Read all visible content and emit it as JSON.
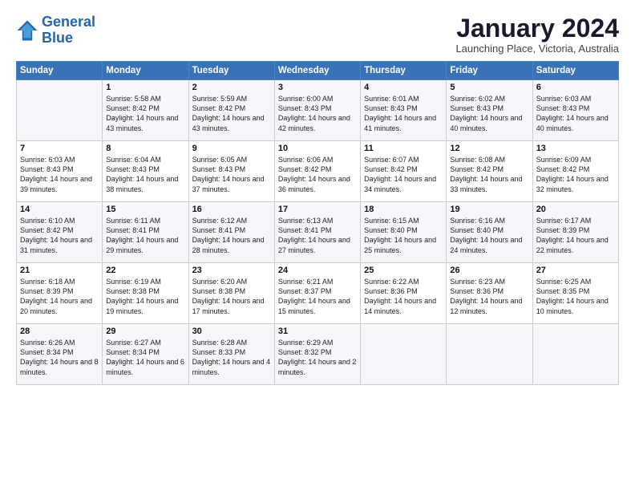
{
  "logo": {
    "line1": "General",
    "line2": "Blue"
  },
  "title": "January 2024",
  "subtitle": "Launching Place, Victoria, Australia",
  "days_header": [
    "Sunday",
    "Monday",
    "Tuesday",
    "Wednesday",
    "Thursday",
    "Friday",
    "Saturday"
  ],
  "weeks": [
    [
      {
        "day": "",
        "sunrise": "",
        "sunset": "",
        "daylight": ""
      },
      {
        "day": "1",
        "sunrise": "Sunrise: 5:58 AM",
        "sunset": "Sunset: 8:42 PM",
        "daylight": "Daylight: 14 hours and 43 minutes."
      },
      {
        "day": "2",
        "sunrise": "Sunrise: 5:59 AM",
        "sunset": "Sunset: 8:42 PM",
        "daylight": "Daylight: 14 hours and 43 minutes."
      },
      {
        "day": "3",
        "sunrise": "Sunrise: 6:00 AM",
        "sunset": "Sunset: 8:43 PM",
        "daylight": "Daylight: 14 hours and 42 minutes."
      },
      {
        "day": "4",
        "sunrise": "Sunrise: 6:01 AM",
        "sunset": "Sunset: 8:43 PM",
        "daylight": "Daylight: 14 hours and 41 minutes."
      },
      {
        "day": "5",
        "sunrise": "Sunrise: 6:02 AM",
        "sunset": "Sunset: 8:43 PM",
        "daylight": "Daylight: 14 hours and 40 minutes."
      },
      {
        "day": "6",
        "sunrise": "Sunrise: 6:03 AM",
        "sunset": "Sunset: 8:43 PM",
        "daylight": "Daylight: 14 hours and 40 minutes."
      }
    ],
    [
      {
        "day": "7",
        "sunrise": "Sunrise: 6:03 AM",
        "sunset": "Sunset: 8:43 PM",
        "daylight": "Daylight: 14 hours and 39 minutes."
      },
      {
        "day": "8",
        "sunrise": "Sunrise: 6:04 AM",
        "sunset": "Sunset: 8:43 PM",
        "daylight": "Daylight: 14 hours and 38 minutes."
      },
      {
        "day": "9",
        "sunrise": "Sunrise: 6:05 AM",
        "sunset": "Sunset: 8:43 PM",
        "daylight": "Daylight: 14 hours and 37 minutes."
      },
      {
        "day": "10",
        "sunrise": "Sunrise: 6:06 AM",
        "sunset": "Sunset: 8:42 PM",
        "daylight": "Daylight: 14 hours and 36 minutes."
      },
      {
        "day": "11",
        "sunrise": "Sunrise: 6:07 AM",
        "sunset": "Sunset: 8:42 PM",
        "daylight": "Daylight: 14 hours and 34 minutes."
      },
      {
        "day": "12",
        "sunrise": "Sunrise: 6:08 AM",
        "sunset": "Sunset: 8:42 PM",
        "daylight": "Daylight: 14 hours and 33 minutes."
      },
      {
        "day": "13",
        "sunrise": "Sunrise: 6:09 AM",
        "sunset": "Sunset: 8:42 PM",
        "daylight": "Daylight: 14 hours and 32 minutes."
      }
    ],
    [
      {
        "day": "14",
        "sunrise": "Sunrise: 6:10 AM",
        "sunset": "Sunset: 8:42 PM",
        "daylight": "Daylight: 14 hours and 31 minutes."
      },
      {
        "day": "15",
        "sunrise": "Sunrise: 6:11 AM",
        "sunset": "Sunset: 8:41 PM",
        "daylight": "Daylight: 14 hours and 29 minutes."
      },
      {
        "day": "16",
        "sunrise": "Sunrise: 6:12 AM",
        "sunset": "Sunset: 8:41 PM",
        "daylight": "Daylight: 14 hours and 28 minutes."
      },
      {
        "day": "17",
        "sunrise": "Sunrise: 6:13 AM",
        "sunset": "Sunset: 8:41 PM",
        "daylight": "Daylight: 14 hours and 27 minutes."
      },
      {
        "day": "18",
        "sunrise": "Sunrise: 6:15 AM",
        "sunset": "Sunset: 8:40 PM",
        "daylight": "Daylight: 14 hours and 25 minutes."
      },
      {
        "day": "19",
        "sunrise": "Sunrise: 6:16 AM",
        "sunset": "Sunset: 8:40 PM",
        "daylight": "Daylight: 14 hours and 24 minutes."
      },
      {
        "day": "20",
        "sunrise": "Sunrise: 6:17 AM",
        "sunset": "Sunset: 8:39 PM",
        "daylight": "Daylight: 14 hours and 22 minutes."
      }
    ],
    [
      {
        "day": "21",
        "sunrise": "Sunrise: 6:18 AM",
        "sunset": "Sunset: 8:39 PM",
        "daylight": "Daylight: 14 hours and 20 minutes."
      },
      {
        "day": "22",
        "sunrise": "Sunrise: 6:19 AM",
        "sunset": "Sunset: 8:38 PM",
        "daylight": "Daylight: 14 hours and 19 minutes."
      },
      {
        "day": "23",
        "sunrise": "Sunrise: 6:20 AM",
        "sunset": "Sunset: 8:38 PM",
        "daylight": "Daylight: 14 hours and 17 minutes."
      },
      {
        "day": "24",
        "sunrise": "Sunrise: 6:21 AM",
        "sunset": "Sunset: 8:37 PM",
        "daylight": "Daylight: 14 hours and 15 minutes."
      },
      {
        "day": "25",
        "sunrise": "Sunrise: 6:22 AM",
        "sunset": "Sunset: 8:36 PM",
        "daylight": "Daylight: 14 hours and 14 minutes."
      },
      {
        "day": "26",
        "sunrise": "Sunrise: 6:23 AM",
        "sunset": "Sunset: 8:36 PM",
        "daylight": "Daylight: 14 hours and 12 minutes."
      },
      {
        "day": "27",
        "sunrise": "Sunrise: 6:25 AM",
        "sunset": "Sunset: 8:35 PM",
        "daylight": "Daylight: 14 hours and 10 minutes."
      }
    ],
    [
      {
        "day": "28",
        "sunrise": "Sunrise: 6:26 AM",
        "sunset": "Sunset: 8:34 PM",
        "daylight": "Daylight: 14 hours and 8 minutes."
      },
      {
        "day": "29",
        "sunrise": "Sunrise: 6:27 AM",
        "sunset": "Sunset: 8:34 PM",
        "daylight": "Daylight: 14 hours and 6 minutes."
      },
      {
        "day": "30",
        "sunrise": "Sunrise: 6:28 AM",
        "sunset": "Sunset: 8:33 PM",
        "daylight": "Daylight: 14 hours and 4 minutes."
      },
      {
        "day": "31",
        "sunrise": "Sunrise: 6:29 AM",
        "sunset": "Sunset: 8:32 PM",
        "daylight": "Daylight: 14 hours and 2 minutes."
      },
      {
        "day": "",
        "sunrise": "",
        "sunset": "",
        "daylight": ""
      },
      {
        "day": "",
        "sunrise": "",
        "sunset": "",
        "daylight": ""
      },
      {
        "day": "",
        "sunrise": "",
        "sunset": "",
        "daylight": ""
      }
    ]
  ]
}
